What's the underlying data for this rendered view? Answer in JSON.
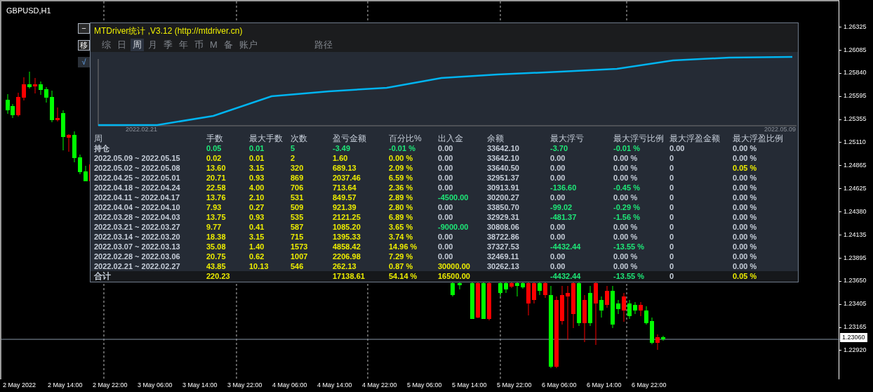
{
  "chart": {
    "symbol": "GBPUSD,H1",
    "price_axis": [
      "1.26325",
      "1.26085",
      "1.25840",
      "1.25595",
      "1.25355",
      "1.25110",
      "1.24865",
      "1.24625",
      "1.24380",
      "1.24135",
      "1.23895",
      "1.23650",
      "1.23405",
      "1.23165",
      "1.22920"
    ],
    "current_price": "1.23060",
    "time_axis": [
      "2 May 2022",
      "2 May 14:00",
      "2 May 22:00",
      "3 May 06:00",
      "3 May 14:00",
      "3 May 22:00",
      "4 May 06:00",
      "4 May 14:00",
      "4 May 22:00",
      "5 May 06:00",
      "5 May 14:00",
      "5 May 22:00",
      "6 May 06:00",
      "6 May 14:00",
      "6 May 22:00"
    ]
  },
  "side_buttons": [
    "−",
    "移",
    "√"
  ],
  "panel": {
    "title": "MTDriver统计 ,V3.12 (http://mtdriver.cn)",
    "tabs": [
      {
        "label": "综",
        "selected": false
      },
      {
        "label": "日",
        "selected": false
      },
      {
        "label": "周",
        "selected": true
      },
      {
        "label": "月",
        "selected": false
      },
      {
        "label": "季",
        "selected": false
      },
      {
        "label": "年",
        "selected": false
      },
      {
        "label": "币",
        "selected": false
      },
      {
        "label": "M",
        "selected": false
      },
      {
        "label": "备",
        "selected": false
      },
      {
        "label": "账户",
        "selected": false
      },
      {
        "label": "路径",
        "selected": false
      }
    ],
    "equity_chart": {
      "start_label": "2022.02.21",
      "end_label": "2022.05.09"
    },
    "table": {
      "columns": [
        "周",
        "手数",
        "最大手数",
        "次数",
        "盈亏金额",
        "百分比%",
        "出入金",
        "余额",
        "最大浮亏",
        "最大浮亏比例",
        "最大浮盈金额",
        "最大浮盈比例"
      ],
      "rows": [
        {
          "cells": [
            {
              "text": "持仓",
              "color": "#c5cdd8"
            },
            {
              "text": "0.05",
              "color": "#1ee878"
            },
            {
              "text": "0.01",
              "color": "#1ee878"
            },
            {
              "text": "5",
              "color": "#1ee878"
            },
            {
              "text": "-3.49",
              "color": "#1ee878"
            },
            {
              "text": "-0.01 %",
              "color": "#1ee878"
            },
            {
              "text": "0.00",
              "color": "#c5cdd8"
            },
            {
              "text": "33642.10",
              "color": "#c5cdd8"
            },
            {
              "text": "-3.70",
              "color": "#1ee878"
            },
            {
              "text": "-0.01 %",
              "color": "#1ee878"
            },
            {
              "text": "0.00",
              "color": "#c5cdd8"
            },
            {
              "text": "0.00 %",
              "color": "#c5cdd8"
            }
          ]
        },
        {
          "cells": [
            {
              "text": "2022.05.09 ~ 2022.05.15",
              "color": "#c5cdd8"
            },
            {
              "text": "0.02",
              "color": "#ecec00"
            },
            {
              "text": "0.01",
              "color": "#ecec00"
            },
            {
              "text": "2",
              "color": "#ecec00"
            },
            {
              "text": "1.60",
              "color": "#ecec00"
            },
            {
              "text": "0.00 %",
              "color": "#ecec00"
            },
            {
              "text": "0.00",
              "color": "#c5cdd8"
            },
            {
              "text": "33642.10",
              "color": "#c5cdd8"
            },
            {
              "text": "0.00",
              "color": "#c5cdd8"
            },
            {
              "text": "0.00 %",
              "color": "#c5cdd8"
            },
            {
              "text": "0",
              "color": "#c5cdd8"
            },
            {
              "text": "0.00 %",
              "color": "#c5cdd8"
            }
          ]
        },
        {
          "cells": [
            {
              "text": "2022.05.02 ~ 2022.05.08",
              "color": "#c5cdd8"
            },
            {
              "text": "13.60",
              "color": "#ecec00"
            },
            {
              "text": "3.15",
              "color": "#ecec00"
            },
            {
              "text": "320",
              "color": "#ecec00"
            },
            {
              "text": "689.13",
              "color": "#ecec00"
            },
            {
              "text": "2.09 %",
              "color": "#ecec00"
            },
            {
              "text": "0.00",
              "color": "#c5cdd8"
            },
            {
              "text": "33640.50",
              "color": "#c5cdd8"
            },
            {
              "text": "0.00",
              "color": "#c5cdd8"
            },
            {
              "text": "0.00 %",
              "color": "#c5cdd8"
            },
            {
              "text": "0",
              "color": "#c5cdd8"
            },
            {
              "text": "0.05 %",
              "color": "#ecec00"
            }
          ]
        },
        {
          "cells": [
            {
              "text": "2022.04.25 ~ 2022.05.01",
              "color": "#c5cdd8"
            },
            {
              "text": "20.71",
              "color": "#ecec00"
            },
            {
              "text": "0.93",
              "color": "#ecec00"
            },
            {
              "text": "869",
              "color": "#ecec00"
            },
            {
              "text": "2037.46",
              "color": "#ecec00"
            },
            {
              "text": "6.59 %",
              "color": "#ecec00"
            },
            {
              "text": "0.00",
              "color": "#c5cdd8"
            },
            {
              "text": "32951.37",
              "color": "#c5cdd8"
            },
            {
              "text": "0.00",
              "color": "#c5cdd8"
            },
            {
              "text": "0.00 %",
              "color": "#c5cdd8"
            },
            {
              "text": "0",
              "color": "#c5cdd8"
            },
            {
              "text": "0.00 %",
              "color": "#c5cdd8"
            }
          ]
        },
        {
          "cells": [
            {
              "text": "2022.04.18 ~ 2022.04.24",
              "color": "#c5cdd8"
            },
            {
              "text": "22.58",
              "color": "#ecec00"
            },
            {
              "text": "4.00",
              "color": "#ecec00"
            },
            {
              "text": "706",
              "color": "#ecec00"
            },
            {
              "text": "713.64",
              "color": "#ecec00"
            },
            {
              "text": "2.36 %",
              "color": "#ecec00"
            },
            {
              "text": "0.00",
              "color": "#c5cdd8"
            },
            {
              "text": "30913.91",
              "color": "#c5cdd8"
            },
            {
              "text": "-136.60",
              "color": "#1ee878"
            },
            {
              "text": "-0.45 %",
              "color": "#1ee878"
            },
            {
              "text": "0",
              "color": "#c5cdd8"
            },
            {
              "text": "0.00 %",
              "color": "#c5cdd8"
            }
          ]
        },
        {
          "cells": [
            {
              "text": "2022.04.11 ~ 2022.04.17",
              "color": "#c5cdd8"
            },
            {
              "text": "13.76",
              "color": "#ecec00"
            },
            {
              "text": "2.10",
              "color": "#ecec00"
            },
            {
              "text": "531",
              "color": "#ecec00"
            },
            {
              "text": "849.57",
              "color": "#ecec00"
            },
            {
              "text": "2.89 %",
              "color": "#ecec00"
            },
            {
              "text": "-4500.00",
              "color": "#1ee878"
            },
            {
              "text": "30200.27",
              "color": "#c5cdd8"
            },
            {
              "text": "0.00",
              "color": "#c5cdd8"
            },
            {
              "text": "0.00 %",
              "color": "#c5cdd8"
            },
            {
              "text": "0",
              "color": "#c5cdd8"
            },
            {
              "text": "0.00 %",
              "color": "#c5cdd8"
            }
          ]
        },
        {
          "cells": [
            {
              "text": "2022.04.04 ~ 2022.04.10",
              "color": "#c5cdd8"
            },
            {
              "text": "7.93",
              "color": "#ecec00"
            },
            {
              "text": "0.27",
              "color": "#ecec00"
            },
            {
              "text": "509",
              "color": "#ecec00"
            },
            {
              "text": "921.39",
              "color": "#ecec00"
            },
            {
              "text": "2.80 %",
              "color": "#ecec00"
            },
            {
              "text": "0.00",
              "color": "#c5cdd8"
            },
            {
              "text": "33850.70",
              "color": "#c5cdd8"
            },
            {
              "text": "-99.02",
              "color": "#1ee878"
            },
            {
              "text": "-0.29 %",
              "color": "#1ee878"
            },
            {
              "text": "0",
              "color": "#c5cdd8"
            },
            {
              "text": "0.00 %",
              "color": "#c5cdd8"
            }
          ]
        },
        {
          "cells": [
            {
              "text": "2022.03.28 ~ 2022.04.03",
              "color": "#c5cdd8"
            },
            {
              "text": "13.75",
              "color": "#ecec00"
            },
            {
              "text": "0.93",
              "color": "#ecec00"
            },
            {
              "text": "535",
              "color": "#ecec00"
            },
            {
              "text": "2121.25",
              "color": "#ecec00"
            },
            {
              "text": "6.89 %",
              "color": "#ecec00"
            },
            {
              "text": "0.00",
              "color": "#c5cdd8"
            },
            {
              "text": "32929.31",
              "color": "#c5cdd8"
            },
            {
              "text": "-481.37",
              "color": "#1ee878"
            },
            {
              "text": "-1.56 %",
              "color": "#1ee878"
            },
            {
              "text": "0",
              "color": "#c5cdd8"
            },
            {
              "text": "0.00 %",
              "color": "#c5cdd8"
            }
          ]
        },
        {
          "cells": [
            {
              "text": "2022.03.21 ~ 2022.03.27",
              "color": "#c5cdd8"
            },
            {
              "text": "9.77",
              "color": "#ecec00"
            },
            {
              "text": "0.41",
              "color": "#ecec00"
            },
            {
              "text": "587",
              "color": "#ecec00"
            },
            {
              "text": "1085.20",
              "color": "#ecec00"
            },
            {
              "text": "3.65 %",
              "color": "#ecec00"
            },
            {
              "text": "-9000.00",
              "color": "#1ee878"
            },
            {
              "text": "30808.06",
              "color": "#c5cdd8"
            },
            {
              "text": "0.00",
              "color": "#c5cdd8"
            },
            {
              "text": "0.00 %",
              "color": "#c5cdd8"
            },
            {
              "text": "0",
              "color": "#c5cdd8"
            },
            {
              "text": "0.00 %",
              "color": "#c5cdd8"
            }
          ]
        },
        {
          "cells": [
            {
              "text": "2022.03.14 ~ 2022.03.20",
              "color": "#c5cdd8"
            },
            {
              "text": "18.38",
              "color": "#ecec00"
            },
            {
              "text": "3.15",
              "color": "#ecec00"
            },
            {
              "text": "715",
              "color": "#ecec00"
            },
            {
              "text": "1395.33",
              "color": "#ecec00"
            },
            {
              "text": "3.74 %",
              "color": "#ecec00"
            },
            {
              "text": "0.00",
              "color": "#c5cdd8"
            },
            {
              "text": "38722.86",
              "color": "#c5cdd8"
            },
            {
              "text": "0.00",
              "color": "#c5cdd8"
            },
            {
              "text": "0.00 %",
              "color": "#c5cdd8"
            },
            {
              "text": "0",
              "color": "#c5cdd8"
            },
            {
              "text": "0.00 %",
              "color": "#c5cdd8"
            }
          ]
        },
        {
          "cells": [
            {
              "text": "2022.03.07 ~ 2022.03.13",
              "color": "#c5cdd8"
            },
            {
              "text": "35.08",
              "color": "#ecec00"
            },
            {
              "text": "1.40",
              "color": "#ecec00"
            },
            {
              "text": "1573",
              "color": "#ecec00"
            },
            {
              "text": "4858.42",
              "color": "#ecec00"
            },
            {
              "text": "14.96 %",
              "color": "#ecec00"
            },
            {
              "text": "0.00",
              "color": "#c5cdd8"
            },
            {
              "text": "37327.53",
              "color": "#c5cdd8"
            },
            {
              "text": "-4432.44",
              "color": "#1ee878"
            },
            {
              "text": "-13.55 %",
              "color": "#1ee878"
            },
            {
              "text": "0",
              "color": "#c5cdd8"
            },
            {
              "text": "0.00 %",
              "color": "#c5cdd8"
            }
          ]
        },
        {
          "cells": [
            {
              "text": "2022.02.28 ~ 2022.03.06",
              "color": "#c5cdd8"
            },
            {
              "text": "20.75",
              "color": "#ecec00"
            },
            {
              "text": "0.62",
              "color": "#ecec00"
            },
            {
              "text": "1007",
              "color": "#ecec00"
            },
            {
              "text": "2206.98",
              "color": "#ecec00"
            },
            {
              "text": "7.29 %",
              "color": "#ecec00"
            },
            {
              "text": "0.00",
              "color": "#c5cdd8"
            },
            {
              "text": "32469.11",
              "color": "#c5cdd8"
            },
            {
              "text": "0.00",
              "color": "#c5cdd8"
            },
            {
              "text": "0.00 %",
              "color": "#c5cdd8"
            },
            {
              "text": "0",
              "color": "#c5cdd8"
            },
            {
              "text": "0.00 %",
              "color": "#c5cdd8"
            }
          ]
        },
        {
          "cells": [
            {
              "text": "2022.02.21 ~ 2022.02.27",
              "color": "#c5cdd8"
            },
            {
              "text": "43.85",
              "color": "#ecec00"
            },
            {
              "text": "10.13",
              "color": "#ecec00"
            },
            {
              "text": "546",
              "color": "#ecec00"
            },
            {
              "text": "262.13",
              "color": "#ecec00"
            },
            {
              "text": "0.87 %",
              "color": "#ecec00"
            },
            {
              "text": "30000.00",
              "color": "#ecec00"
            },
            {
              "text": "30262.13",
              "color": "#c5cdd8"
            },
            {
              "text": "0.00",
              "color": "#c5cdd8"
            },
            {
              "text": "0.00 %",
              "color": "#c5cdd8"
            },
            {
              "text": "0",
              "color": "#c5cdd8"
            },
            {
              "text": "0.00 %",
              "color": "#c5cdd8"
            }
          ]
        }
      ],
      "total": {
        "cells": [
          {
            "text": "合计",
            "color": "#c5cdd8"
          },
          {
            "text": "220.23",
            "color": "#ecec00"
          },
          null,
          null,
          {
            "text": "17138.61",
            "color": "#ecec00"
          },
          {
            "text": "54.14 %",
            "color": "#ecec00"
          },
          {
            "text": "16500.00",
            "color": "#ecec00"
          },
          null,
          {
            "text": "-4432.44",
            "color": "#1ee878"
          },
          {
            "text": "-13.55 %",
            "color": "#1ee878"
          },
          {
            "text": "0",
            "color": "#c5cdd8"
          },
          {
            "text": "0.05 %",
            "color": "#ecec00"
          }
        ]
      }
    }
  }
}
